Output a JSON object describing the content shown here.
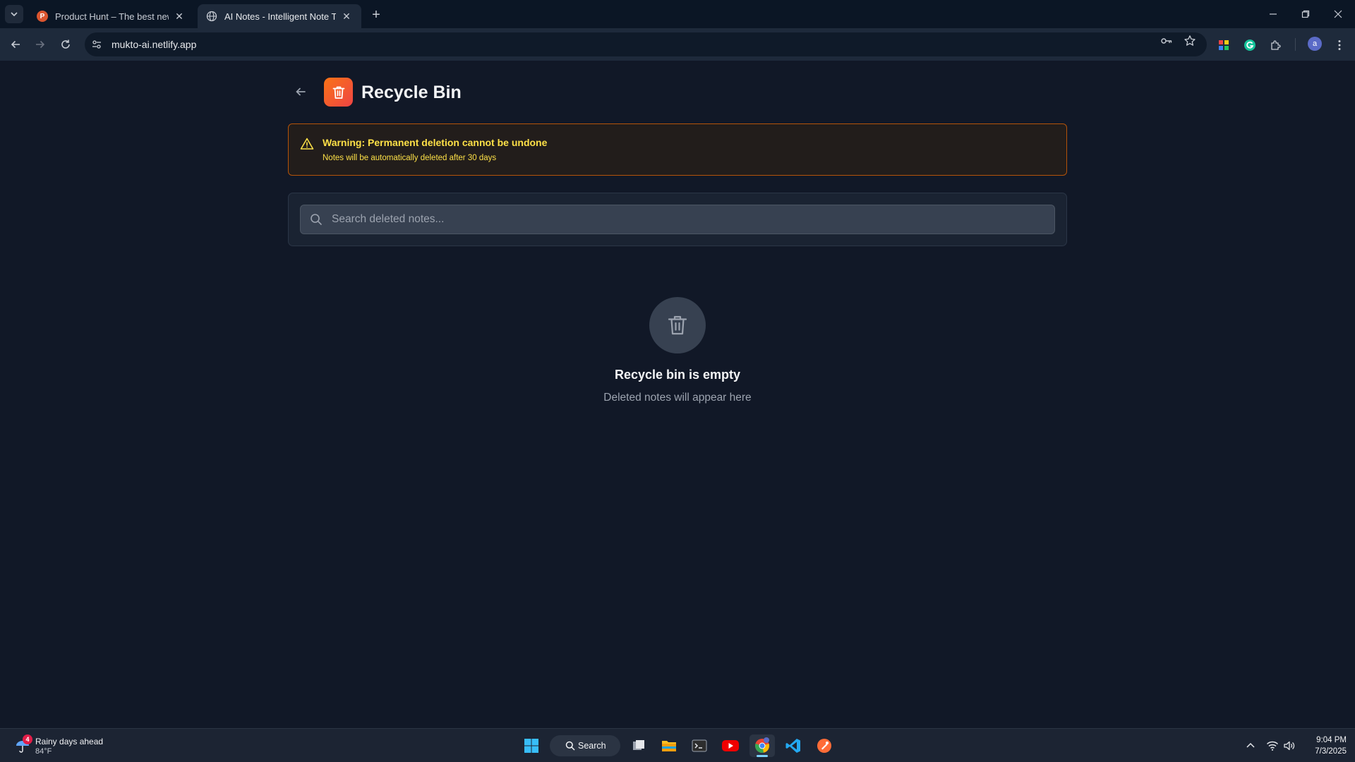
{
  "browser": {
    "tabs": [
      {
        "title": "Product Hunt – The best new products in tech",
        "favicon": "P",
        "active": false
      },
      {
        "title": "AI Notes - Intelligent Note Taking",
        "favicon": "globe",
        "active": true
      }
    ],
    "url": "mukto-ai.netlify.app",
    "profile_initial": "a"
  },
  "page": {
    "title": "Recycle Bin",
    "warning": {
      "title": "Warning: Permanent deletion cannot be undone",
      "subtitle": "Notes will be automatically deleted after 30 days"
    },
    "search": {
      "placeholder": "Search deleted notes..."
    },
    "empty_state": {
      "title": "Recycle bin is empty",
      "subtitle": "Deleted notes will appear here"
    }
  },
  "taskbar": {
    "weather": {
      "title": "Rainy days ahead",
      "temp": "84°F",
      "badge": "4"
    },
    "search_label": "Search",
    "time": "9:04 PM",
    "date": "7/3/2025"
  },
  "colors": {
    "accent_gradient_start": "#f97316",
    "accent_gradient_end": "#ef4444",
    "warning_border": "#b45309",
    "warning_text": "#fde047",
    "page_bg": "#111827"
  }
}
